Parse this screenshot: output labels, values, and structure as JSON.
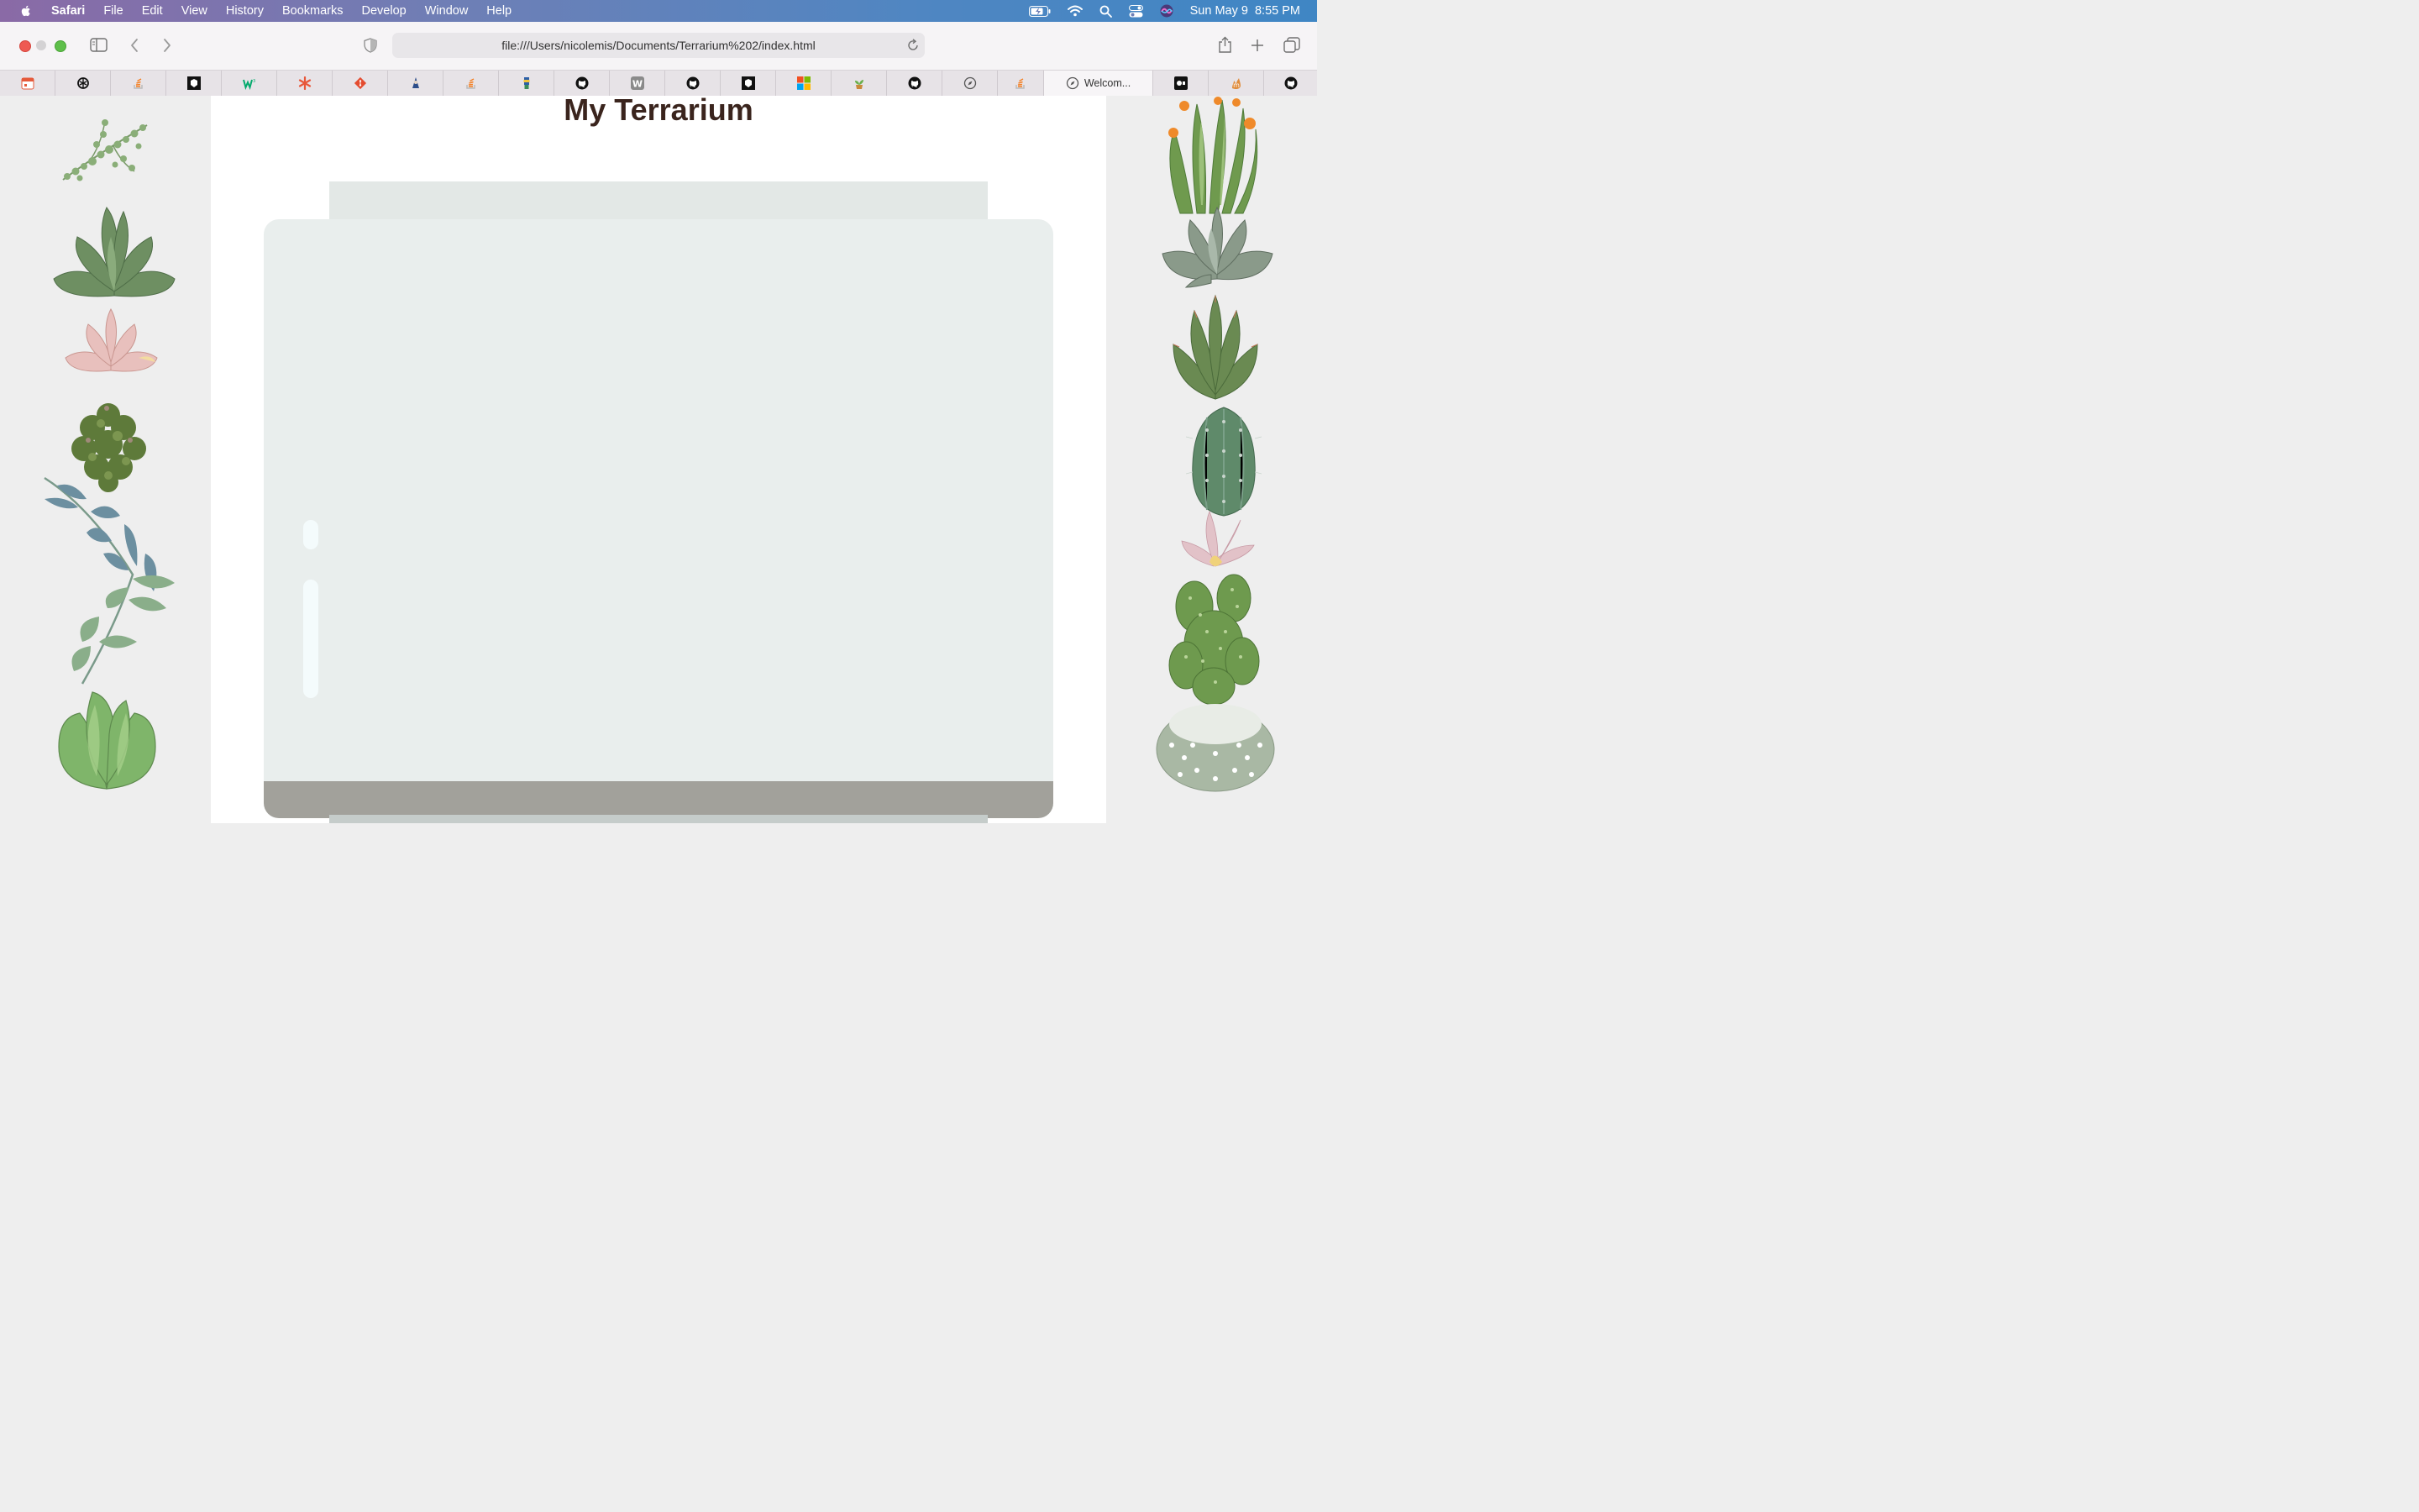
{
  "menubar": {
    "app_name": "Safari",
    "items": [
      "File",
      "Edit",
      "View",
      "History",
      "Bookmarks",
      "Develop",
      "Window",
      "Help"
    ],
    "datetime": "Sun May 9  8:55 PM"
  },
  "toolbar": {
    "url": "file:///Users/nicolemis/Documents/Terrarium%202/index.html"
  },
  "tabs": {
    "active_label": "Welcom...",
    "favicons": [
      "calendar-icon",
      "openai-icon",
      "stackoverflow-icon",
      "codepen-icon",
      "w3schools-icon",
      "asterisk-icon",
      "git-icon",
      "wizard-icon",
      "stackoverflow-icon",
      "lighthouse-icon",
      "github-icon",
      "wordpress-icon",
      "github-icon",
      "codepen-icon",
      "microsoft-icon",
      "plant-icon",
      "github-icon",
      "compass-icon",
      "stackoverflow-icon",
      "compass-icon",
      "camera-icon",
      "fire-icon",
      "github-icon"
    ]
  },
  "page": {
    "title": "My Terrarium"
  },
  "colors": {
    "title": "#3a241d",
    "jar": "#e9eeed",
    "jar_top": "#e3e8e6",
    "soil": "#a2a19b"
  }
}
